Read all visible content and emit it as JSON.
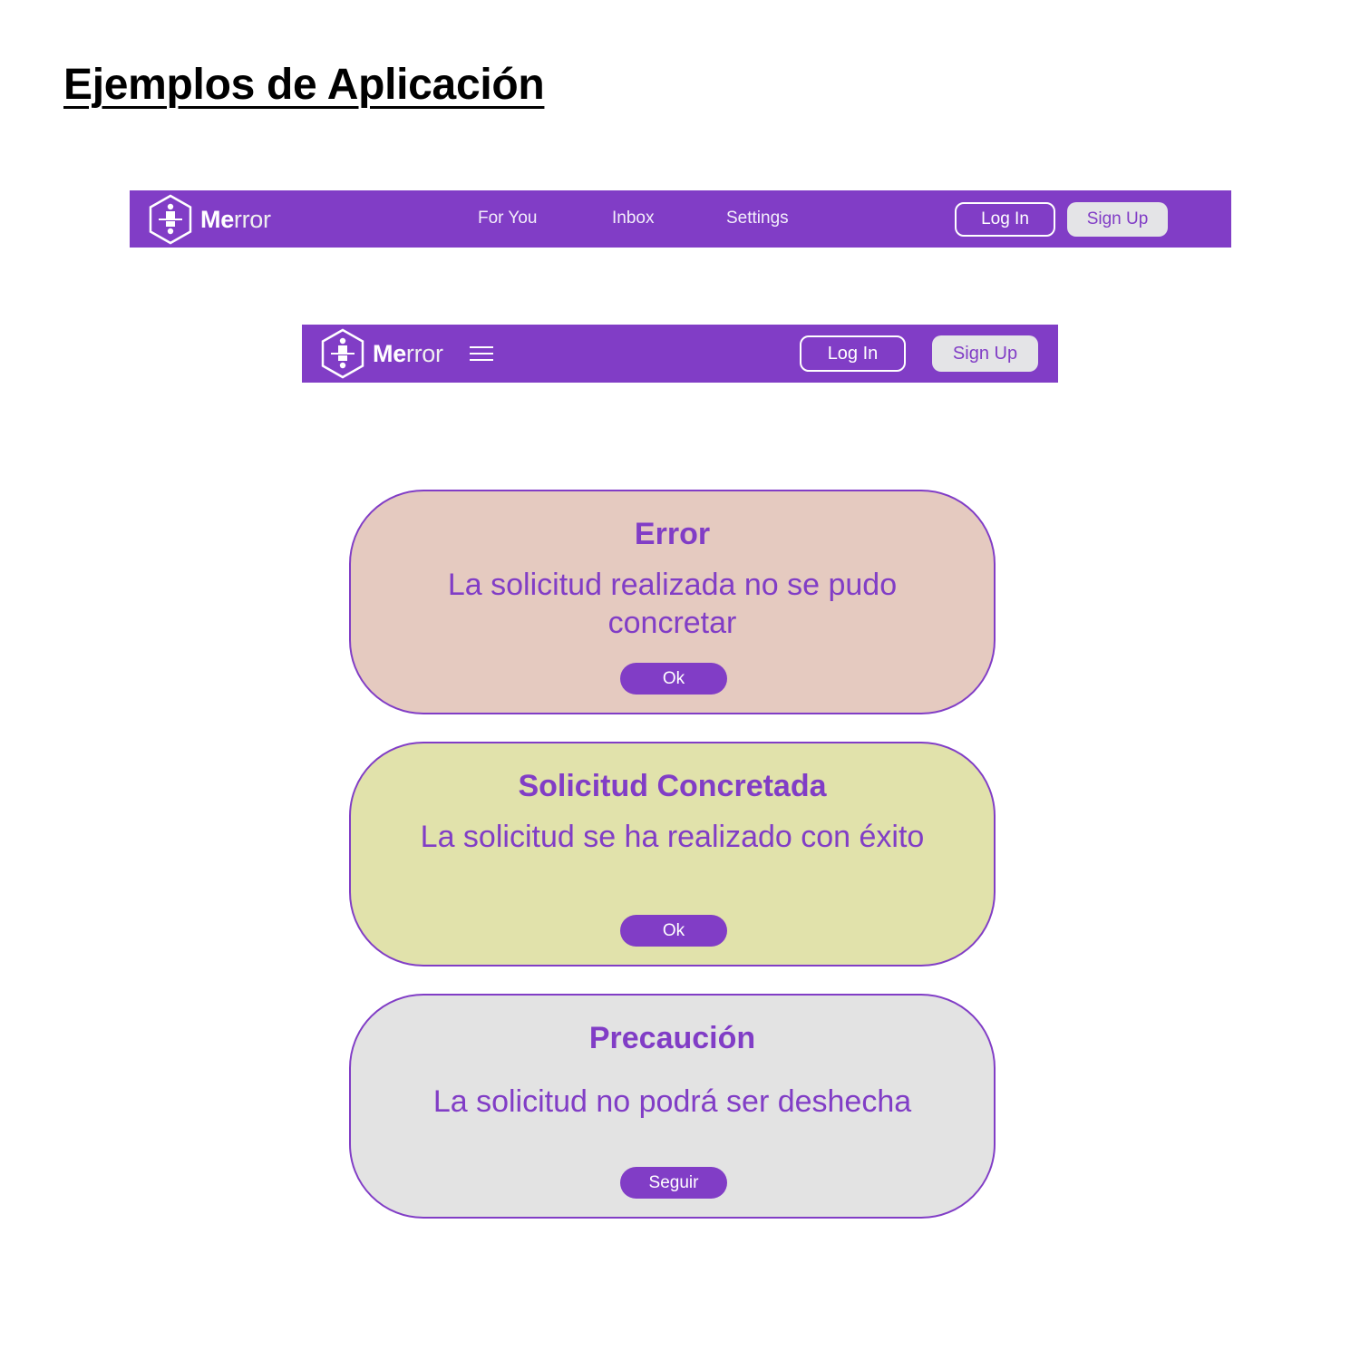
{
  "page": {
    "title": "Ejemplos de Aplicación"
  },
  "colors": {
    "brand_purple": "#813dc6",
    "error_bg": "#e5cac0",
    "success_bg": "#e1e2ab",
    "warning_bg": "#e3e3e3",
    "button_light": "#e4e4e7"
  },
  "navbar_desktop": {
    "logo_icon": "hexagon-figure-icon",
    "brand_bold": "Me",
    "brand_light": "rror",
    "links": [
      "For You",
      "Inbox",
      "Settings"
    ],
    "login_label": "Log In",
    "signup_label": "Sign Up"
  },
  "navbar_mobile": {
    "logo_icon": "hexagon-figure-icon",
    "brand_bold": "Me",
    "brand_light": "rror",
    "menu_icon": "hamburger-menu-icon",
    "login_label": "Log In",
    "signup_label": "Sign Up"
  },
  "dialogs": {
    "error": {
      "title": "Error",
      "message": "La solicitud realizada no se pudo concretar",
      "button": "Ok"
    },
    "success": {
      "title": "Solicitud Concretada",
      "message": "La solicitud se ha realizado con éxito",
      "button": "Ok"
    },
    "warning": {
      "title": "Precaución",
      "message": "La solicitud no podrá ser deshecha",
      "button": "Seguir"
    }
  }
}
